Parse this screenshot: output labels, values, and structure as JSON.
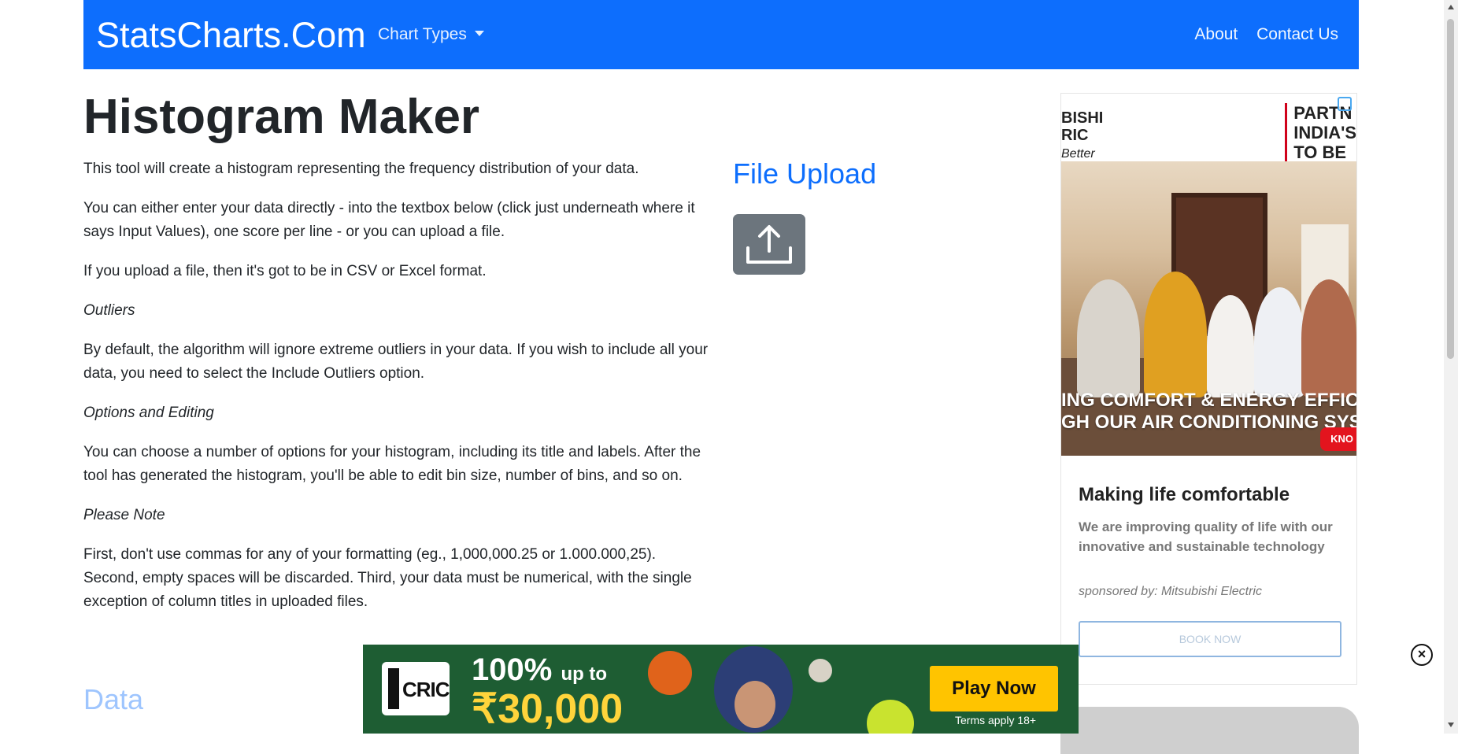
{
  "navbar": {
    "brand": "StatsCharts.Com",
    "chart_types": "Chart Types",
    "about": "About",
    "contact": "Contact Us"
  },
  "page": {
    "title": "Histogram Maker",
    "paragraphs": [
      "This tool will create a histogram representing the frequency distribution of your data.",
      "You can either enter your data directly - into the textbox below (click just underneath where it says Input Values), one score per line - or you can upload a file.",
      "If you upload a file, then it's got to be in CSV or Excel format.",
      "Outliers",
      "By default, the algorithm will ignore extreme outliers in your data. If you wish to include all your data, you need to select the Include Outliers option.",
      "Options and Editing",
      "You can choose a number of options for your histogram, including its title and labels. After the tool has generated the histogram, you'll be able to edit bin size, number of bins, and so on.",
      "Please Note",
      "First, don't use commas for any of your formatting (eg., 1,000,000.25 or 1.000.000,25). Second, empty spaces will be discarded. Third, your data must be numerical, with the single exception of column titles in uploaded files."
    ],
    "data_heading": "Data"
  },
  "upload": {
    "title": "File Upload",
    "icon": "upload-icon"
  },
  "side_ad": {
    "brand_left": [
      "BISHI",
      "RIC"
    ],
    "brand_left_tagline": "Better",
    "brand_right": [
      "PARTN",
      "INDIA'S",
      "TO BE"
    ],
    "banner_line1": "ING COMFORT & ENERGY EFFICI",
    "banner_line2": "GH OUR AIR CONDITIONING SYST",
    "badge": "KNO",
    "headline": "Making life comfortable",
    "body": "We are improving quality of life with our innovative and sustainable technology",
    "sponsor": "sponsored by: Mitsubishi Electric",
    "cta": "BOOK NOW"
  },
  "bottom_ad": {
    "logo_text": "CRIC",
    "promo_percent": "100%",
    "promo_upto": "up to",
    "promo_amount": "₹30,000",
    "button": "Play Now",
    "terms": "Terms apply 18+"
  },
  "colors": {
    "navbar": "#0d6efd",
    "upload_button": "#6c757d",
    "ad_green": "#1e5d33",
    "play_button": "#ffc400"
  }
}
